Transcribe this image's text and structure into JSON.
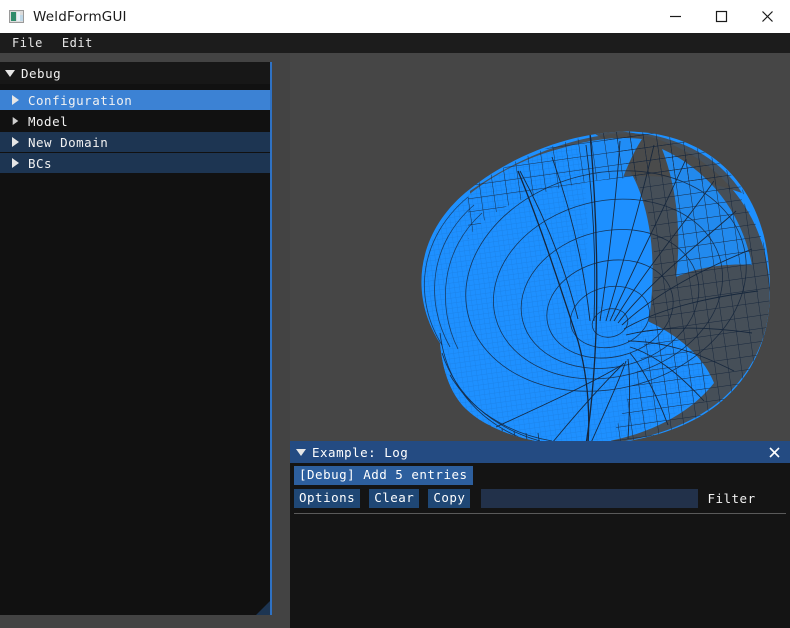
{
  "window": {
    "title": "WeldFormGUI",
    "icon": "app-image-icon",
    "controls": {
      "minimize": "minimize-icon",
      "maximize": "maximize-icon",
      "close": "close-icon"
    }
  },
  "menubar": {
    "items": [
      {
        "label": "File"
      },
      {
        "label": "Edit"
      }
    ]
  },
  "debug_panel": {
    "title": "Debug",
    "collapse_icon": "triangle-down-icon",
    "items": [
      {
        "label": "Configuration",
        "state": "selected",
        "arrow": "triangle-right-icon"
      },
      {
        "label": "Model",
        "state": "plain",
        "arrow": "triangle-right-icon"
      },
      {
        "label": "New Domain",
        "state": "idle",
        "arrow": "triangle-right-icon"
      },
      {
        "label": "BCs",
        "state": "idle",
        "arrow": "triangle-right-icon"
      }
    ],
    "resize_grip": "resize-grip-icon"
  },
  "viewport": {
    "name": "3d-mesh-viewport",
    "background_color": "#464646",
    "mesh_fill_color": "#1e90ff",
    "mesh_wire_color": "#16263c"
  },
  "log_window": {
    "title": "Example: Log",
    "collapse_icon": "triangle-down-icon",
    "close_icon": "close-icon",
    "add_entries_button": "[Debug] Add 5 entries",
    "buttons": [
      {
        "label": "Options"
      },
      {
        "label": "Clear"
      },
      {
        "label": "Copy"
      }
    ],
    "filter": {
      "value": "",
      "placeholder": "",
      "label": "Filter"
    },
    "entries": []
  },
  "colors": {
    "accent_blue": "#3c82d4",
    "panel_blue": "#1d3552",
    "title_blue": "#244b82",
    "button_blue": "#1f4775",
    "button_blue_hot": "#2d5f9e",
    "mesh_blue": "#1e90ff",
    "workspace_gray": "#434343",
    "panel_black": "#111111"
  }
}
